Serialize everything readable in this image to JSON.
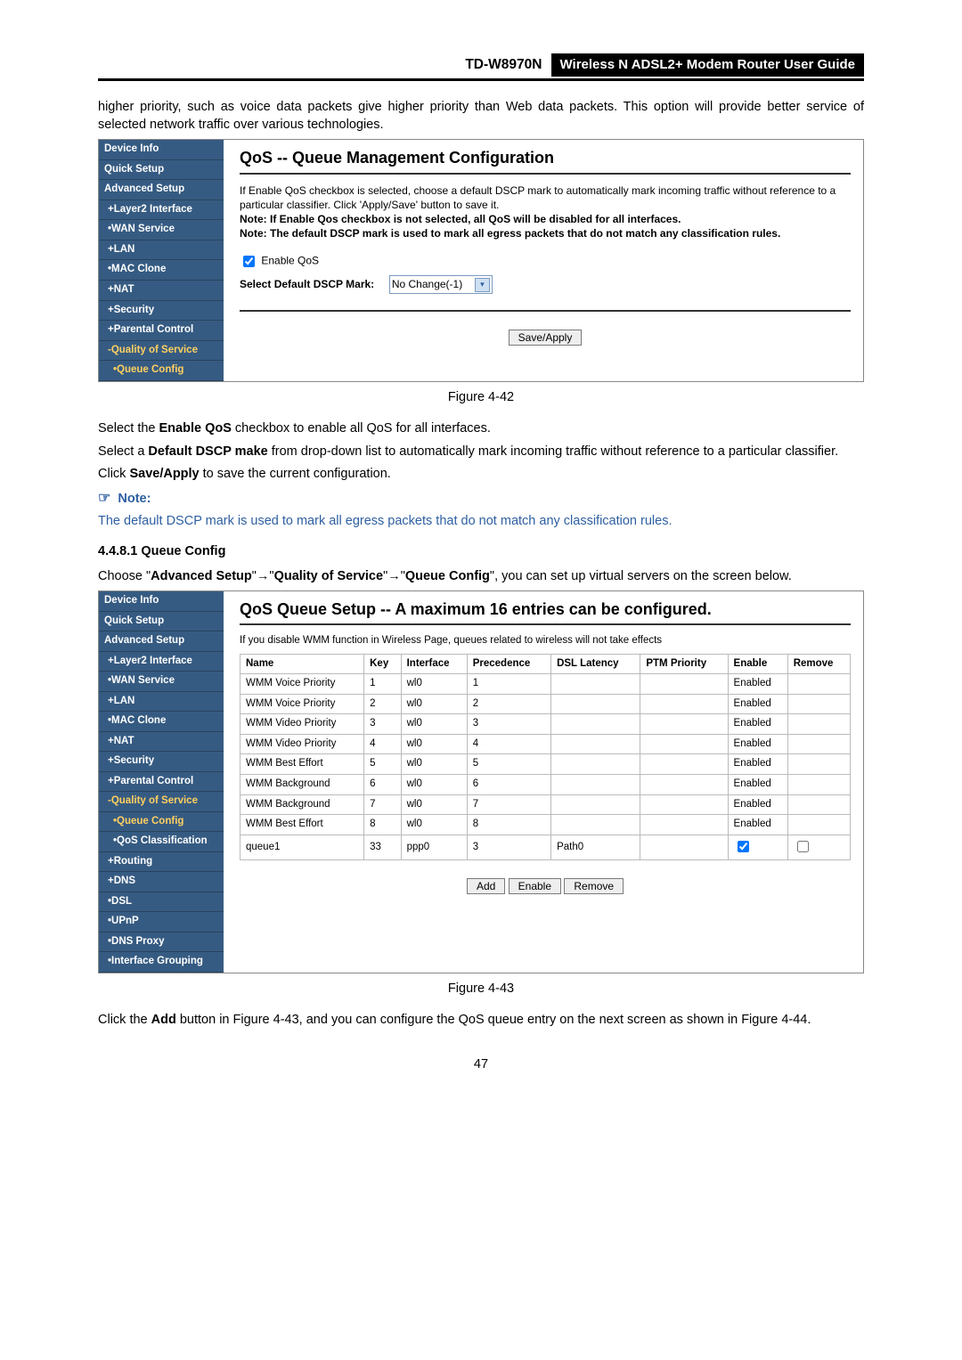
{
  "header": {
    "model": "TD-W8970N",
    "desc": "Wireless  N  ADSL2+  Modem  Router  User  Guide"
  },
  "para_intro": "higher priority, such as voice data packets give higher priority than Web data packets. This option will provide better service of selected network traffic over various technologies.",
  "fig42": {
    "sidebar": [
      {
        "label": "Device Info",
        "cls": ""
      },
      {
        "label": "Quick Setup",
        "cls": ""
      },
      {
        "label": "Advanced Setup",
        "cls": ""
      },
      {
        "label": "+Layer2 Interface",
        "cls": "sub"
      },
      {
        "label": "•WAN Service",
        "cls": "sub"
      },
      {
        "label": "+LAN",
        "cls": "sub"
      },
      {
        "label": "•MAC Clone",
        "cls": "sub"
      },
      {
        "label": "+NAT",
        "cls": "sub"
      },
      {
        "label": "+Security",
        "cls": "sub"
      },
      {
        "label": "+Parental Control",
        "cls": "sub"
      },
      {
        "label": "-Quality of Service",
        "cls": "sub active"
      },
      {
        "label": "•Queue Config",
        "cls": "sub2 active"
      }
    ],
    "title": "QoS -- Queue Management Configuration",
    "text1": "If Enable QoS checkbox is selected, choose a default DSCP mark to automatically mark incoming traffic without reference to a particular classifier. Click 'Apply/Save' button to save it.",
    "text2": "Note: If Enable Qos checkbox is not selected, all QoS will be disabled for all interfaces.",
    "text3": "Note: The default DSCP mark is used to mark all egress packets that do not match any classification rules.",
    "enable_label": "Enable QoS",
    "dscp_label": "Select Default DSCP Mark:",
    "dscp_value": "No Change(-1)",
    "save_btn": "Save/Apply"
  },
  "cap42": "Figure 4-42",
  "para_enable_pre": "Select the ",
  "para_enable_bold": "Enable QoS",
  "para_enable_post": " checkbox to enable all QoS for all interfaces.",
  "para_dscp_pre": "Select a ",
  "para_dscp_bold": "Default DSCP make",
  "para_dscp_post": " from drop-down list to automatically mark incoming traffic without reference to a particular classifier.",
  "para_save_pre": "Click ",
  "para_save_bold": "Save/Apply",
  "para_save_post": " to save the current configuration.",
  "note_head": "Note:",
  "note_body": "The default DSCP mark is used to mark all egress packets that do not match any classification rules.",
  "sect_num": "4.4.8.1   Queue Config",
  "para_choose_1": "Choose  \"",
  "para_choose_b1": "Advanced  Setup",
  "para_choose_2": "\"→\"",
  "para_choose_b2": "Quality  of  Service",
  "para_choose_3": "\"→\"",
  "para_choose_b3": "Queue  Config",
  "para_choose_4": "\",  you  can  set  up  virtual servers on the screen below.",
  "fig43": {
    "sidebar": [
      {
        "label": "Device Info",
        "cls": ""
      },
      {
        "label": "Quick Setup",
        "cls": ""
      },
      {
        "label": "Advanced Setup",
        "cls": ""
      },
      {
        "label": "+Layer2 Interface",
        "cls": "sub"
      },
      {
        "label": "•WAN Service",
        "cls": "sub"
      },
      {
        "label": "+LAN",
        "cls": "sub"
      },
      {
        "label": "•MAC Clone",
        "cls": "sub"
      },
      {
        "label": "+NAT",
        "cls": "sub"
      },
      {
        "label": "+Security",
        "cls": "sub"
      },
      {
        "label": "+Parental Control",
        "cls": "sub"
      },
      {
        "label": "-Quality of Service",
        "cls": "sub active"
      },
      {
        "label": "•Queue Config",
        "cls": "sub2 active"
      },
      {
        "label": "•QoS Classification",
        "cls": "sub2"
      },
      {
        "label": "+Routing",
        "cls": "sub"
      },
      {
        "label": "+DNS",
        "cls": "sub"
      },
      {
        "label": "•DSL",
        "cls": "sub"
      },
      {
        "label": "•UPnP",
        "cls": "sub"
      },
      {
        "label": "•DNS Proxy",
        "cls": "sub"
      },
      {
        "label": "•Interface Grouping",
        "cls": "sub"
      }
    ],
    "title": "QoS Queue Setup -- A maximum 16 entries can be configured.",
    "subnote": "If you disable WMM function in Wireless Page, queues related to wireless will not take effects",
    "cols": [
      "Name",
      "Key",
      "Interface",
      "Precedence",
      "DSL Latency",
      "PTM Priority",
      "Enable",
      "Remove"
    ],
    "rows": [
      {
        "name": "WMM Voice Priority",
        "key": "1",
        "iface": "wl0",
        "prec": "1",
        "dsl": "",
        "ptm": "",
        "enable": "Enabled",
        "remove": ""
      },
      {
        "name": "WMM Voice Priority",
        "key": "2",
        "iface": "wl0",
        "prec": "2",
        "dsl": "",
        "ptm": "",
        "enable": "Enabled",
        "remove": ""
      },
      {
        "name": "WMM Video Priority",
        "key": "3",
        "iface": "wl0",
        "prec": "3",
        "dsl": "",
        "ptm": "",
        "enable": "Enabled",
        "remove": ""
      },
      {
        "name": "WMM Video Priority",
        "key": "4",
        "iface": "wl0",
        "prec": "4",
        "dsl": "",
        "ptm": "",
        "enable": "Enabled",
        "remove": ""
      },
      {
        "name": "WMM Best Effort",
        "key": "5",
        "iface": "wl0",
        "prec": "5",
        "dsl": "",
        "ptm": "",
        "enable": "Enabled",
        "remove": ""
      },
      {
        "name": "WMM Background",
        "key": "6",
        "iface": "wl0",
        "prec": "6",
        "dsl": "",
        "ptm": "",
        "enable": "Enabled",
        "remove": ""
      },
      {
        "name": "WMM Background",
        "key": "7",
        "iface": "wl0",
        "prec": "7",
        "dsl": "",
        "ptm": "",
        "enable": "Enabled",
        "remove": ""
      },
      {
        "name": "WMM Best Effort",
        "key": "8",
        "iface": "wl0",
        "prec": "8",
        "dsl": "",
        "ptm": "",
        "enable": "Enabled",
        "remove": ""
      },
      {
        "name": "queue1",
        "key": "33",
        "iface": "ppp0",
        "prec": "3",
        "dsl": "Path0",
        "ptm": "",
        "enable": "_checkbox_checked",
        "remove": "_checkbox_empty"
      }
    ],
    "btn_add": "Add",
    "btn_enable": "Enable",
    "btn_remove": "Remove"
  },
  "cap43": "Figure 4-43",
  "para_add_1": "Click the ",
  "para_add_b": "Add",
  "para_add_2": " button in Figure 4-43, and you can configure the QoS queue entry on the next screen as shown in Figure 4-44.",
  "pagenum": "47"
}
